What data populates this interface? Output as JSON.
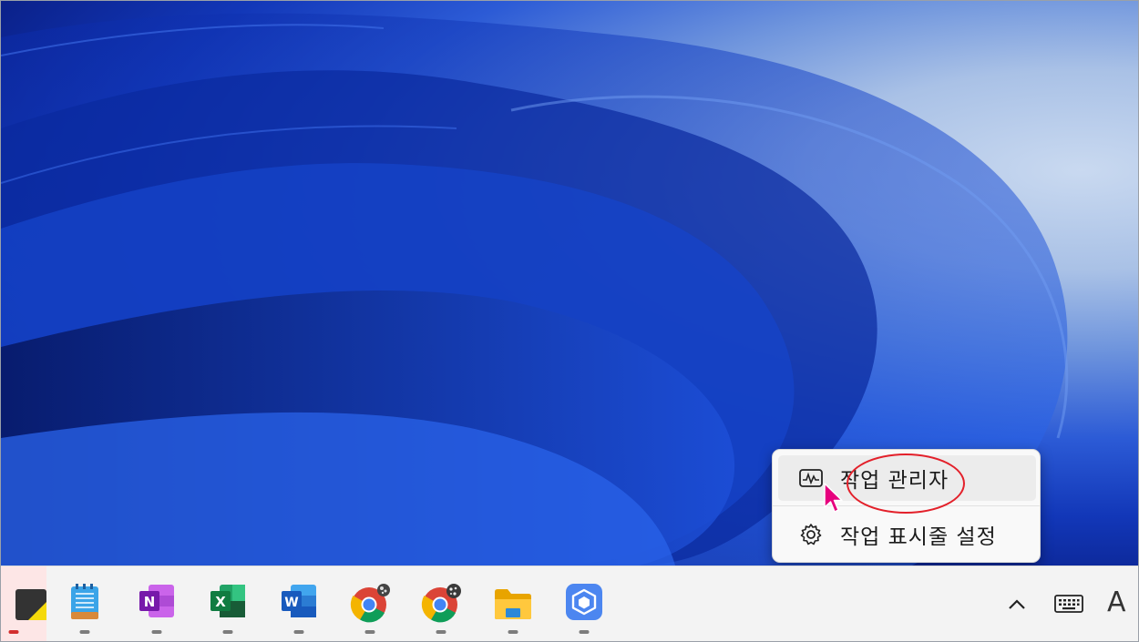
{
  "context_menu": {
    "items": [
      {
        "label": "작업 관리자",
        "icon": "task-manager-icon",
        "hovered": true
      },
      {
        "label": "작업 표시줄 설정",
        "icon": "gear-icon",
        "hovered": false
      }
    ]
  },
  "taskbar": {
    "apps": [
      {
        "name": "sticky-notes",
        "icon": "sticky-notes-icon",
        "running": true,
        "active": true
      },
      {
        "name": "notepad",
        "icon": "notepad-icon",
        "running": true
      },
      {
        "name": "onenote",
        "icon": "onenote-icon",
        "letter": "N",
        "color": "#7719aa",
        "running": true
      },
      {
        "name": "excel",
        "icon": "excel-icon",
        "letter": "X",
        "color": "#107c41",
        "running": true
      },
      {
        "name": "word",
        "icon": "word-icon",
        "letter": "W",
        "color": "#185abd",
        "running": true
      },
      {
        "name": "chrome-1",
        "icon": "chrome-icon",
        "running": true
      },
      {
        "name": "chrome-2",
        "icon": "chrome-icon",
        "running": true
      },
      {
        "name": "file-explorer",
        "icon": "folder-icon",
        "running": true
      },
      {
        "name": "app-cube",
        "icon": "cube-app-icon",
        "running": true
      }
    ],
    "tray": {
      "overflow_icon": "chevron-up-icon",
      "keyboard_icon": "keyboard-icon",
      "ime_label": "A"
    }
  },
  "colors": {
    "annotation": "#e3202a",
    "cursor": "#e6007e"
  }
}
